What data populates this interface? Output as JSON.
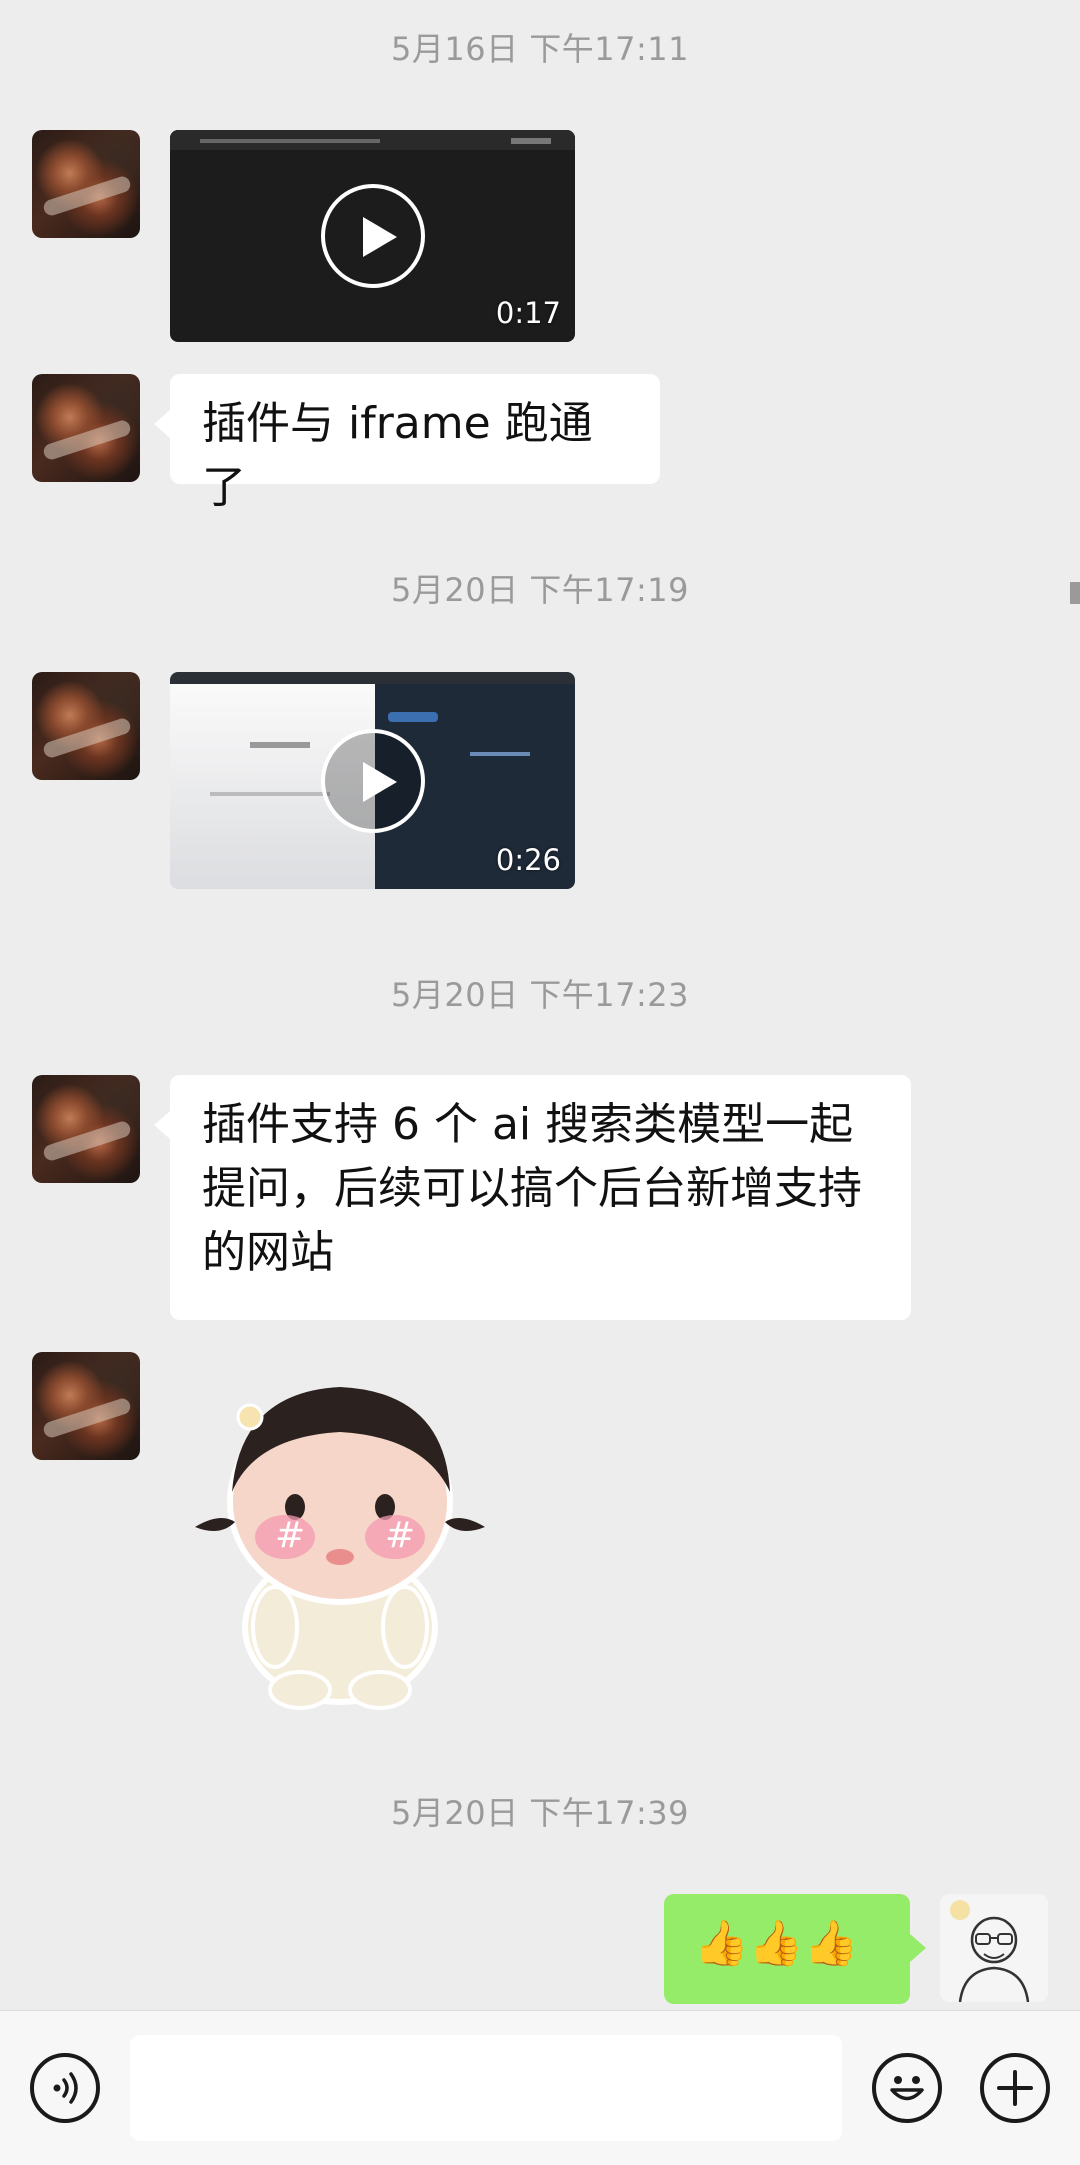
{
  "messages": {
    "ts1": "5月16日 下午17:11",
    "video1_duration": "0:17",
    "text1": "插件与 iframe 跑通了",
    "ts2": "5月20日 下午17:19",
    "video2_duration": "0:26",
    "ts3": "5月20日 下午17:23",
    "text2": "插件支持 6 个 ai 搜索类模型一起提问，后续可以搞个后台新增支持的网站",
    "ts4": "5月20日 下午17:39",
    "text3_emoji": "👍👍👍"
  },
  "icons": {
    "voice": "voice-icon",
    "emoji": "emoji-icon",
    "plus": "plus-icon"
  },
  "colors": {
    "background": "#ededed",
    "self_bubble": "#95ec69",
    "other_bubble": "#ffffff"
  }
}
